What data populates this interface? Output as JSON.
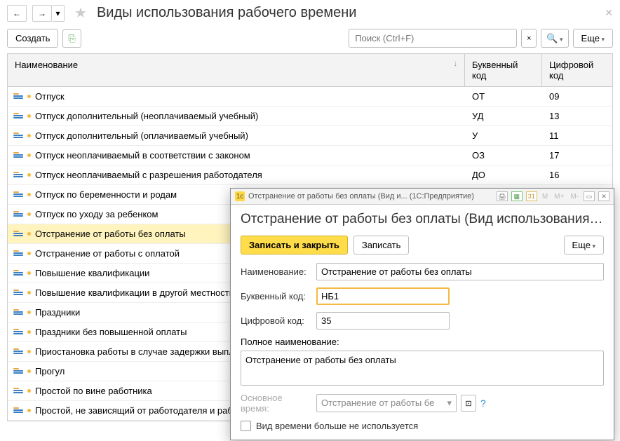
{
  "header": {
    "title": "Виды использования рабочего времени"
  },
  "toolbar": {
    "create": "Создать",
    "search_placeholder": "Поиск (Ctrl+F)",
    "more": "Еще"
  },
  "table": {
    "columns": {
      "name": "Наименование",
      "letter": "Буквенный код",
      "digit": "Цифровой код"
    },
    "rows": [
      {
        "name": "Отпуск",
        "letter": "ОТ",
        "digit": "09"
      },
      {
        "name": "Отпуск дополнительный (неоплачиваемый учебный)",
        "letter": "УД",
        "digit": "13"
      },
      {
        "name": "Отпуск дополнительный (оплачиваемый учебный)",
        "letter": "У",
        "digit": "11"
      },
      {
        "name": "Отпуск неоплачиваемый в соответствии с законом",
        "letter": "ОЗ",
        "digit": "17"
      },
      {
        "name": "Отпуск неоплачиваемый с разрешения работодателя",
        "letter": "ДО",
        "digit": "16"
      },
      {
        "name": "Отпуск по беременности и родам",
        "letter": "",
        "digit": ""
      },
      {
        "name": "Отпуск по уходу за ребенком",
        "letter": "",
        "digit": ""
      },
      {
        "name": "Отстранение от работы без оплаты",
        "letter": "",
        "digit": "",
        "selected": true
      },
      {
        "name": "Отстранение от работы с оплатой",
        "letter": "",
        "digit": ""
      },
      {
        "name": "Повышение квалификации",
        "letter": "",
        "digit": ""
      },
      {
        "name": "Повышение квалификации в другой местности",
        "letter": "",
        "digit": ""
      },
      {
        "name": "Праздники",
        "letter": "",
        "digit": ""
      },
      {
        "name": "Праздники без повышенной оплаты",
        "letter": "",
        "digit": ""
      },
      {
        "name": "Приостановка работы в случае задержки выпл...",
        "letter": "",
        "digit": ""
      },
      {
        "name": "Прогул",
        "letter": "",
        "digit": ""
      },
      {
        "name": "Простой по вине работника",
        "letter": "",
        "digit": ""
      },
      {
        "name": "Простой, не зависящий от работодателя и раб...",
        "letter": "",
        "digit": ""
      }
    ]
  },
  "modal": {
    "titlebar": "Отстранение от работы без оплаты (Вид и...  (1С:Предприятие)",
    "heading": "Отстранение от работы без оплаты (Вид использования р...",
    "save_close": "Записать и закрыть",
    "save": "Записать",
    "more": "Еще",
    "labels": {
      "name": "Наименование:",
      "letter": "Буквенный код:",
      "digit": "Цифровой код:",
      "full": "Полное наименование:",
      "main_time": "Основное время:",
      "not_used": "Вид времени больше не используется"
    },
    "values": {
      "name": "Отстранение от работы без оплаты",
      "letter": "НБ1",
      "digit": "35",
      "full": "Отстранение от работы без оплаты",
      "main_time": "Отстранение от работы бе"
    }
  }
}
